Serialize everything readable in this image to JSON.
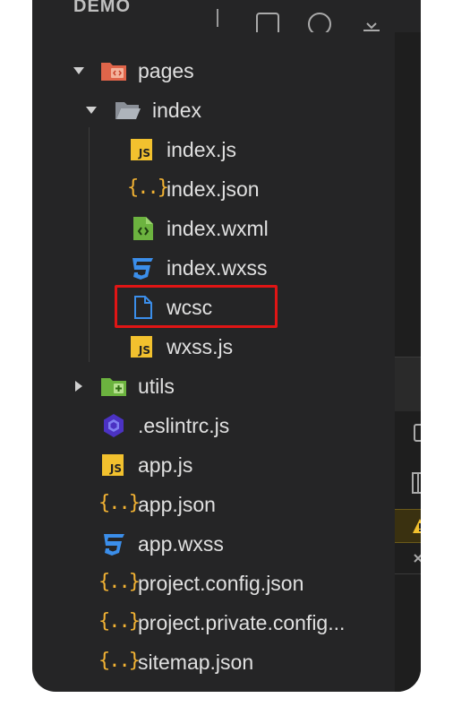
{
  "explorer": {
    "title": "DEMO",
    "items": [
      {
        "label": "pages",
        "type": "folder",
        "open": true
      },
      {
        "label": "index",
        "type": "folder",
        "open": true
      },
      {
        "label": "index.js",
        "type": "js"
      },
      {
        "label": "index.json",
        "type": "json"
      },
      {
        "label": "index.wxml",
        "type": "wxml"
      },
      {
        "label": "index.wxss",
        "type": "wxss"
      },
      {
        "label": "wcsc",
        "type": "file",
        "highlighted": true
      },
      {
        "label": "wxss.js",
        "type": "js"
      },
      {
        "label": "utils",
        "type": "folder",
        "open": false
      },
      {
        "label": ".eslintrc.js",
        "type": "eslint"
      },
      {
        "label": "app.js",
        "type": "js"
      },
      {
        "label": "app.json",
        "type": "json"
      },
      {
        "label": "app.wxss",
        "type": "wxss"
      },
      {
        "label": "project.config.json",
        "type": "json"
      },
      {
        "label": "project.private.config...",
        "type": "json"
      },
      {
        "label": "sitemap.json",
        "type": "json"
      }
    ]
  },
  "icons": {
    "js_text": "JS",
    "json_text": "{..}"
  },
  "colors": {
    "background": "#252526",
    "highlight_border": "#e01515",
    "js_badge": "#f2c12e",
    "json_brace": "#f2b233",
    "css_icon": "#3b8eea",
    "folder_pages": "#e0654a",
    "folder_utils": "#6cb33f"
  }
}
